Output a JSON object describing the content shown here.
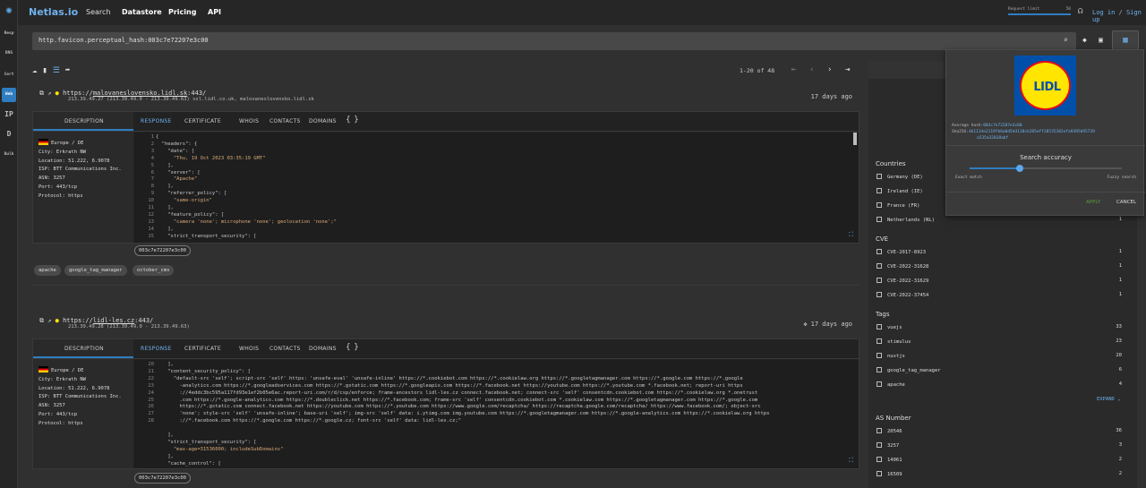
{
  "brand": {
    "name": "Netlas.io"
  },
  "nav": [
    {
      "label": "Search"
    },
    {
      "label": "Datastore"
    },
    {
      "label": "Pricing"
    },
    {
      "label": "API"
    }
  ],
  "rate_limit": {
    "label": "Request limit",
    "value": "50"
  },
  "auth": {
    "login": "Log in",
    "divider": "/",
    "signup": "Sign up"
  },
  "sidebar": [
    {
      "label": "Resp",
      "icon": "responses-icon"
    },
    {
      "label": "DNS",
      "icon": "dns-icon"
    },
    {
      "label": "Cert",
      "icon": "certificate-icon"
    },
    {
      "label": "Web",
      "icon": "globe-icon"
    },
    {
      "label": "IP",
      "icon": "ip-whois-icon"
    },
    {
      "label": "D",
      "icon": "domain-whois-icon"
    },
    {
      "label": "Bulk",
      "icon": "download-icon"
    }
  ],
  "search": {
    "query": "http.favicon.perceptual_hash:003c7e72207e3c00"
  },
  "pagination": {
    "label": "1-20 of 48"
  },
  "results": [
    {
      "url_prefix": "https://",
      "host": "malovaneslovensko.lidl.sk",
      "port_suffix": ":443/",
      "ip": "213.39.49.27",
      "ip_range": "(213.39.49.0 - 213.39.49.63)",
      "domains": [
        "ssl.lidl.co.uk",
        "malovaneslovensko.lidl.sk"
      ],
      "age": "17 days ago",
      "tabs": [
        "DESCRIPTION",
        "RESPONSE",
        "CERTIFICATE",
        "WHOIS",
        "CONTACTS",
        "DOMAINS",
        "{ }"
      ],
      "location": "Europe / DE",
      "city": "City: Erkrath NW",
      "loc_label": "Location:",
      "loc_value": "51.222, 6.9078",
      "isp": "ISP: BTT Communications Inc.",
      "asn": "ASN: 3257",
      "port_label": "Port:",
      "port_value": "443/tcp",
      "proto_label": "Protocol:",
      "proto_value": "https",
      "line_numbers": [
        "1",
        "2",
        "3",
        "4",
        "5",
        "6",
        "7",
        "8",
        "9",
        "10",
        "11",
        "12",
        "13",
        "14",
        "15"
      ],
      "code": [
        "{",
        "  \"headers\": {",
        "    \"date\": [",
        "      \"Thu, 19 Oct 2023 03:35:19 GMT\"",
        "    ],",
        "    \"server\": [",
        "      \"Apache\"",
        "    ],",
        "    \"referrer_policy\": [",
        "      \"same-origin\"",
        "    ],",
        "    \"feature_policy\": [",
        "      \"camera 'none'; microphone 'none'; geolocation 'none';\"",
        "    ],",
        "    \"strict_transport_security\": ["
      ],
      "hash": "003c7e72207e3c00",
      "tags": [
        "apache",
        "google_tag_manager",
        "october_cms"
      ]
    },
    {
      "url_prefix": "https://",
      "host": "lidl-les.cz",
      "port_suffix": ":443/",
      "ip": "213.39.49.28",
      "ip_range": "(213.39.49.0 - 213.39.49.63)",
      "domains": [],
      "age": "17 days ago",
      "tabs": [
        "DESCRIPTION",
        "RESPONSE",
        "CERTIFICATE",
        "WHOIS",
        "CONTACTS",
        "DOMAINS",
        "{ }"
      ],
      "location": "Europe / DE",
      "city": "City: Erkrath NW",
      "loc_label": "Location:",
      "loc_value": "51.222, 6.9078",
      "isp": "ISP: BTT Communications Inc.",
      "asn": "ASN: 3257",
      "port_label": "Port:",
      "port_value": "443/tcp",
      "proto_label": "Protocol:",
      "proto_value": "https",
      "line_numbers": [
        "20",
        "21",
        "22",
        "",
        "",
        "",
        "",
        "",
        "",
        "",
        "23",
        "24",
        "25",
        "26",
        "27",
        "28"
      ],
      "code": [
        "    ],",
        "    \"content_security_policy\": [",
        "      \"default-src 'self'; script-src 'self' https: 'unsafe-eval' 'unsafe-inline' https://*.cookiebot.com https://*.cookielaw.org https://*.googletagmanager.com https://*.google.com https://*.google",
        "        -analytics.com https://*.googleadservices.com https://*.gstatic.com https://*.googleapis.com https://*.facebook.net https://youtube.com https://*.youtube.com *.facebook.net; report-uri https",
        "        ://4eddc3bc595a117fd93e1ef2b05e6ac.report-uri.com/r/d/csp/enforce; frame-ancestors lidl-les.cz connect.facebook.net; connect-src 'self' consentcdn.cookiebot.com https://*.cookielaw.org *.onetrust",
        "        .com https://*.google-analytics.com https://*.doubleclick.net https://*.facebook.com; frame-src 'self' consentcdn.cookiebot.com *.cookielaw.com https://*.googletagmanager.com https://*.google.com",
        "        https://*.gstatic.com connect.facebook.net https://youtube.com https://*.youtube.com https://www.google.com/recaptcha/ https://recaptcha.google.com/recaptcha/ https://www.facebook.com/; object-src",
        "        'none'; style-src 'self' 'unsafe-inline'; base-uri 'self'; img-src 'self' data: i.ytimg.com img.youtube.com https://*.googletagmanager.com https://*.google-analytics.com https://*.cookielaw.org https",
        "        ://*.facebook.com https://*.google.com https://*.google.cz; font-src 'self' data: lidl-les.cz;\"",
        "",
        "    ],",
        "    \"strict_transport_security\": [",
        "      \"max-age=31536000; includeSubDomains\"",
        "    ],",
        "    \"cache_control\": [",
        "      \"no-store, no-cache, must-revalidate\""
      ],
      "hash": "003c7e72207e3c00",
      "tags": []
    }
  ],
  "facets": {
    "countries": {
      "title": "Countries",
      "items": [
        {
          "label": "Germany (DE)",
          "count": "1"
        },
        {
          "label": "Ireland (IE)",
          "count": "1"
        },
        {
          "label": "France (FR)",
          "count": "1"
        },
        {
          "label": "Netherlands (NL)",
          "count": "1"
        }
      ]
    },
    "cve": {
      "title": "CVE",
      "items": [
        {
          "label": "CVE-2017-8923",
          "count": "1"
        },
        {
          "label": "CVE-2022-31628",
          "count": "1"
        },
        {
          "label": "CVE-2022-31629",
          "count": "1"
        },
        {
          "label": "CVE-2022-37454",
          "count": "1"
        }
      ]
    },
    "tags": {
      "title": "Tags",
      "items": [
        {
          "label": "vuejs",
          "count": "33"
        },
        {
          "label": "stimulus",
          "count": "23"
        },
        {
          "label": "nuxtjs",
          "count": "20"
        },
        {
          "label": "google_tag_manager",
          "count": "6"
        },
        {
          "label": "apache",
          "count": "4"
        }
      ],
      "expand": "EXPAND"
    },
    "asn": {
      "title": "AS Number",
      "items": [
        {
          "label": "20546",
          "count": "36"
        },
        {
          "label": "3257",
          "count": "3"
        },
        {
          "label": "14061",
          "count": "2"
        },
        {
          "label": "16509",
          "count": "2"
        }
      ]
    }
  },
  "favicon_popup": {
    "logo_text": "LIDL",
    "avg_label": "Average hash:",
    "avg_value": "003c7e72207e3c00",
    "sha_label": "Sha256:",
    "sha_value": "4b1114e2119fb6a0d5d4118cb285eff28535382efa9395b95739",
    "sha_value2": "a535a32018abf",
    "accuracy_title": "Search accuracy",
    "accuracy_level": 0.33,
    "exact_label": "Exact match",
    "fuzzy_label": "Fuzzy search",
    "apply": "APPLY",
    "cancel": "CANCEL"
  }
}
